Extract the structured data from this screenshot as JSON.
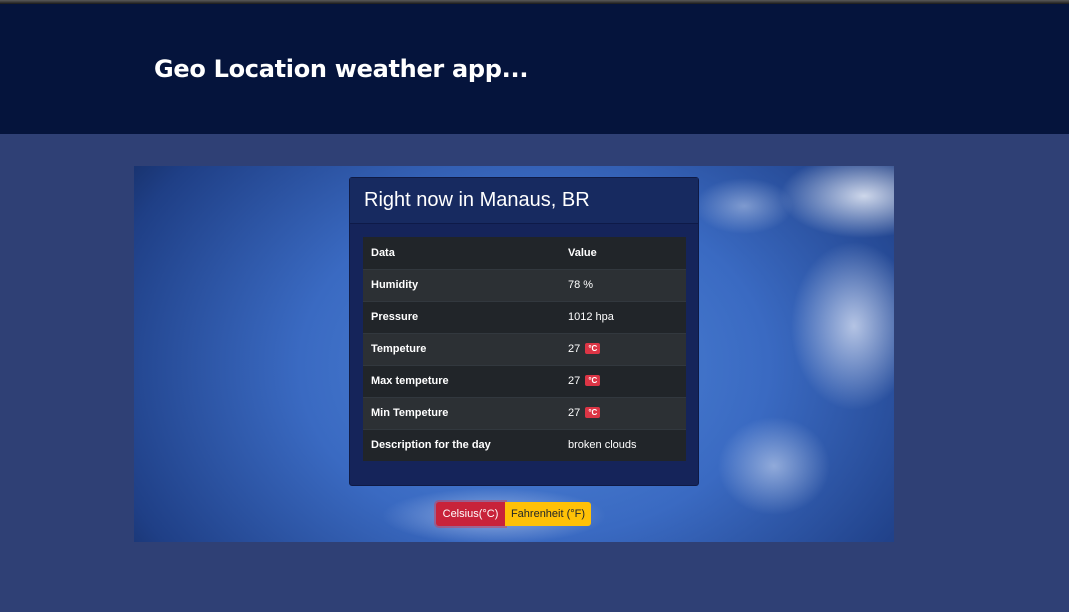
{
  "header": {
    "title": "Geo Location weather app..."
  },
  "card": {
    "title": "Right now in Manaus, BR",
    "table": {
      "columns": [
        "Data",
        "Value"
      ],
      "rows": [
        {
          "label": "Humidity",
          "value": "78 %"
        },
        {
          "label": "Pressure",
          "value": "1012 hpa"
        },
        {
          "label": "Tempeture",
          "value": "27",
          "unit": "°C"
        },
        {
          "label": "Max tempeture",
          "value": "27",
          "unit": "°C"
        },
        {
          "label": "Min Tempeture",
          "value": "27",
          "unit": "°C"
        },
        {
          "label": "Description for the day",
          "value": "broken clouds"
        }
      ]
    }
  },
  "units": {
    "celsius_label": "Celsius(°C)",
    "fahrenheit_label": "Fahrenheit (°F)",
    "selected": "celsius"
  },
  "colors": {
    "header_bg": "#05143c",
    "page_bg": "#2f4075",
    "celsius_button": "#c8233a",
    "fahrenheit_button": "#ffc107",
    "unit_badge": "#dc3545"
  }
}
